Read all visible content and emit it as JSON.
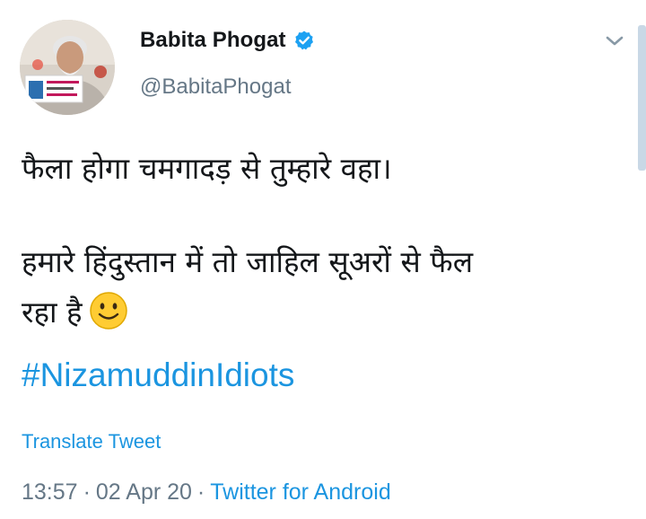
{
  "user": {
    "display_name": "Babita Phogat",
    "handle": "@BabitaPhogat",
    "verified": true,
    "avatar_icon": "profile-photo"
  },
  "tweet": {
    "lines": [
      "फैला होगा चमगादड़ से तुम्हारे वहा।",
      "हमारे हिंदुस्तान में तो जाहिल सूअरों से फैल",
      "रहा है"
    ],
    "emoji_icon": "slightly-smiling-face",
    "hashtag": "#NizamuddinIdiots",
    "translate_label": "Translate Tweet"
  },
  "meta": {
    "time": "13:57",
    "separator": "·",
    "date": "02 Apr 20",
    "client": "Twitter for Android"
  },
  "colors": {
    "text": "#14171a",
    "secondary": "#657786",
    "link": "#1b95e0",
    "verified": "#1da1f2"
  },
  "icons": {
    "menu": "chevron-down-icon",
    "verified": "verified-badge-icon"
  }
}
